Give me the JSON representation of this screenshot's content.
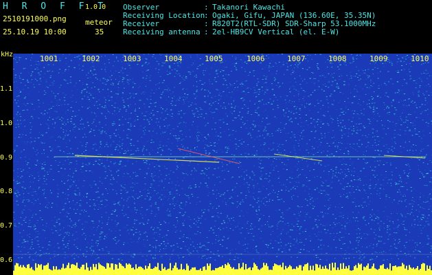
{
  "header": {
    "app_title": "H R O F F T",
    "version": "1.0.0",
    "filename": "2510191000.png",
    "datetime": "25.10.19 10:00",
    "meteor_label": "meteor",
    "meteor_count": "35",
    "info": [
      {
        "label": "Observer",
        "sep": ":",
        "value": "Takanori Kawachi"
      },
      {
        "label": "Receiving Location",
        "sep": ":",
        "value": "Ogaki, Gifu, JAPAN (136.60E, 35.35N)"
      },
      {
        "label": "Receiver",
        "sep": ":",
        "value": "R820T2(RTL-SDR) SDR-Sharp 53.1000MHz"
      },
      {
        "label": "Receiving antenna",
        "sep": ":",
        "value": "2el-HB9CV Vertical (el. E-W)"
      }
    ]
  },
  "plot": {
    "y_unit": "kHz",
    "y_ticks": [
      "1.1",
      "1.0",
      "0.9",
      "0.8",
      "0.7",
      "0.6"
    ],
    "x_ticks": [
      "1001",
      "1002",
      "1003",
      "1004",
      "1005",
      "1006",
      "1007",
      "1008",
      "1009",
      "1010"
    ],
    "colors": {
      "background": "#1a3ab8",
      "noise": "#2ec8d8",
      "signal": "#ffff40",
      "axis_text": "#ffff55",
      "info_text": "#4ee6e6"
    }
  }
}
